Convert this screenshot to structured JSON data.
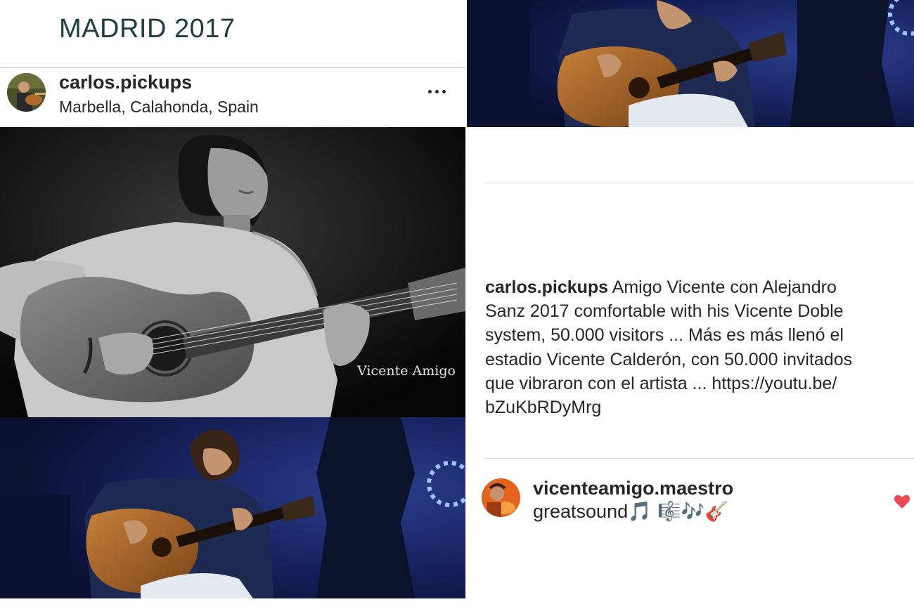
{
  "page_title": "MADRID  2017",
  "post": {
    "username": "carlos.pickups",
    "location": "Marbella, Calahonda, Spain",
    "more_icon": "more-horizontal-icon"
  },
  "photo": {
    "watermark": "Vicente Amigo"
  },
  "caption": {
    "username": "carlos.pickups",
    "text": "Amigo Vicente con Alejandro\nSanz 2017 comfortable with his Vicente Doble\nsystem, 50.000 visitors ... Más es más llenó el\nestadio Vicente Calderón, con 50.000 invitados\nque vibraron con el artista ... https://youtu.be/\nbZuKbRDyMrg"
  },
  "comment": {
    "username": "vicenteamigo.maestro",
    "text": "greatsound",
    "emoji": "🎵 🎼🎶🎸",
    "like_icon": "heart-icon",
    "like_color": "#ed4956"
  }
}
